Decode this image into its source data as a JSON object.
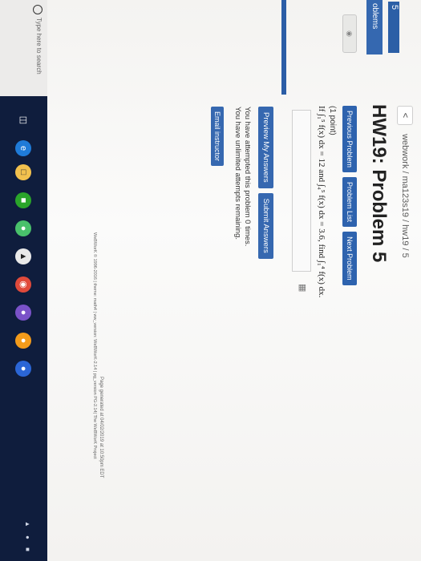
{
  "left_panel": {
    "number": "5",
    "problems_label": "oblems"
  },
  "breadcrumb": {
    "back_symbol": "<",
    "path": "webwork / ma123s19 / hw19 / 5"
  },
  "title": "HW19: Problem 5",
  "nav": {
    "previous": "Previous Problem",
    "list": "Problem List",
    "next": "Next Problem"
  },
  "problem": {
    "points": "(1 point)",
    "statement": "If ∫₁⁵ f(x) dx = 12 and ∫₄⁵ f(x) dx = 3.6, find ∫₁⁴ f(x) dx."
  },
  "actions": {
    "preview": "Preview My Answers",
    "submit": "Submit Answers"
  },
  "attempts": {
    "line1": "You have attempted this problem 0 times.",
    "line2": "You have unlimited attempts remaining."
  },
  "email": "Email instructor",
  "footer": {
    "generated": "Page generated at 04/02/2019 at 10:50pm EDT",
    "copyright": "WeBWorK © 1996-2016 | theme: math4 | ww_version: WeBWorK-2.14 | pg_version PG-2.14| The WeBWorK Project"
  },
  "taskbar": {
    "search_placeholder": "Type here to search"
  },
  "colors": {
    "accent": "#2e63ae",
    "taskbar": "#0f1d3d"
  }
}
